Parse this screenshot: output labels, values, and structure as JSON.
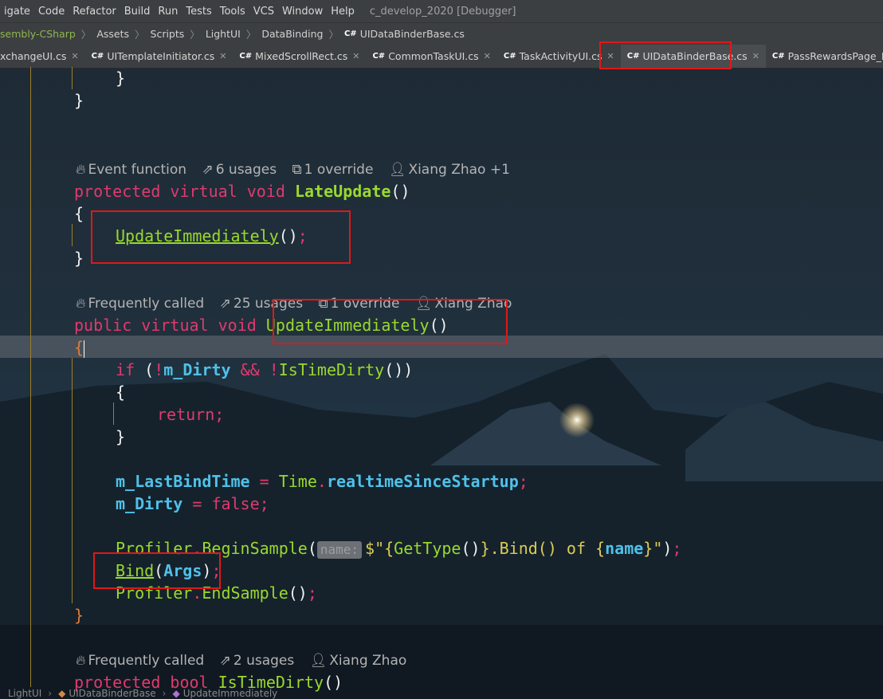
{
  "menu": {
    "items": [
      "igate",
      "Code",
      "Refactor",
      "Build",
      "Run",
      "Tests",
      "Tools",
      "VCS",
      "Window",
      "Help"
    ],
    "window_title": "c_develop_2020 [Debugger]"
  },
  "breadcrumb": {
    "items": [
      "sembly-CSharp",
      "Assets",
      "Scripts",
      "LightUI",
      "DataBinding",
      "UIDataBinderBase.cs"
    ]
  },
  "tabs": [
    {
      "label": "xchangeUI.cs"
    },
    {
      "label": "UITemplateInitiator.cs"
    },
    {
      "label": "MixedScrollRect.cs"
    },
    {
      "label": "CommonTaskUI.cs"
    },
    {
      "label": "TaskActivityUI.cs"
    },
    {
      "label": "UIDataBinderBase.cs",
      "active": true
    },
    {
      "label": "PassRewardsPage_Rewards"
    }
  ],
  "code": {
    "hint1": {
      "a": "Event function",
      "b": "6 usages",
      "c": "1 override",
      "d": "Xiang Zhao +1"
    },
    "hint2": {
      "a": "Frequently called",
      "b": "25 usages",
      "c": "1 override",
      "d": "Xiang Zhao"
    },
    "hint3": {
      "a": "Frequently called",
      "b": "2 usages",
      "d": "Xiang Zhao"
    },
    "tok": {
      "protected": "protected",
      "virtual": "virtual",
      "void": "void",
      "public": "public",
      "bool": "bool",
      "LateUpdate": "LateUpdate",
      "UpdateImmediately": "UpdateImmediately",
      "IsTimeDirty": "IsTimeDirty",
      "if": "if",
      "mDirty": "m_Dirty",
      "return": "return",
      "mLastBindTime": "m_LastBindTime",
      "Time": "Time",
      "realtime": "realtimeSinceStartup",
      "false": "false",
      "Profiler": "Profiler",
      "BeginSample": "BeginSample",
      "EndSample": "EndSample",
      "name_param": "name:",
      "strOpen": "$\"{",
      "GetType": "GetType",
      "strMid": "}.Bind() of {",
      "name": "name",
      "strClose": "}\"",
      "Bind": "Bind",
      "Args": "Args"
    }
  },
  "status": {
    "items": [
      "LightUI",
      "UIDataBinderBase",
      "UpdateImmediately"
    ]
  },
  "colors": {
    "keyword": "#e03a6e",
    "function": "#9ad92d",
    "field": "#4fc1e9",
    "highlight_box": "#e01818"
  }
}
